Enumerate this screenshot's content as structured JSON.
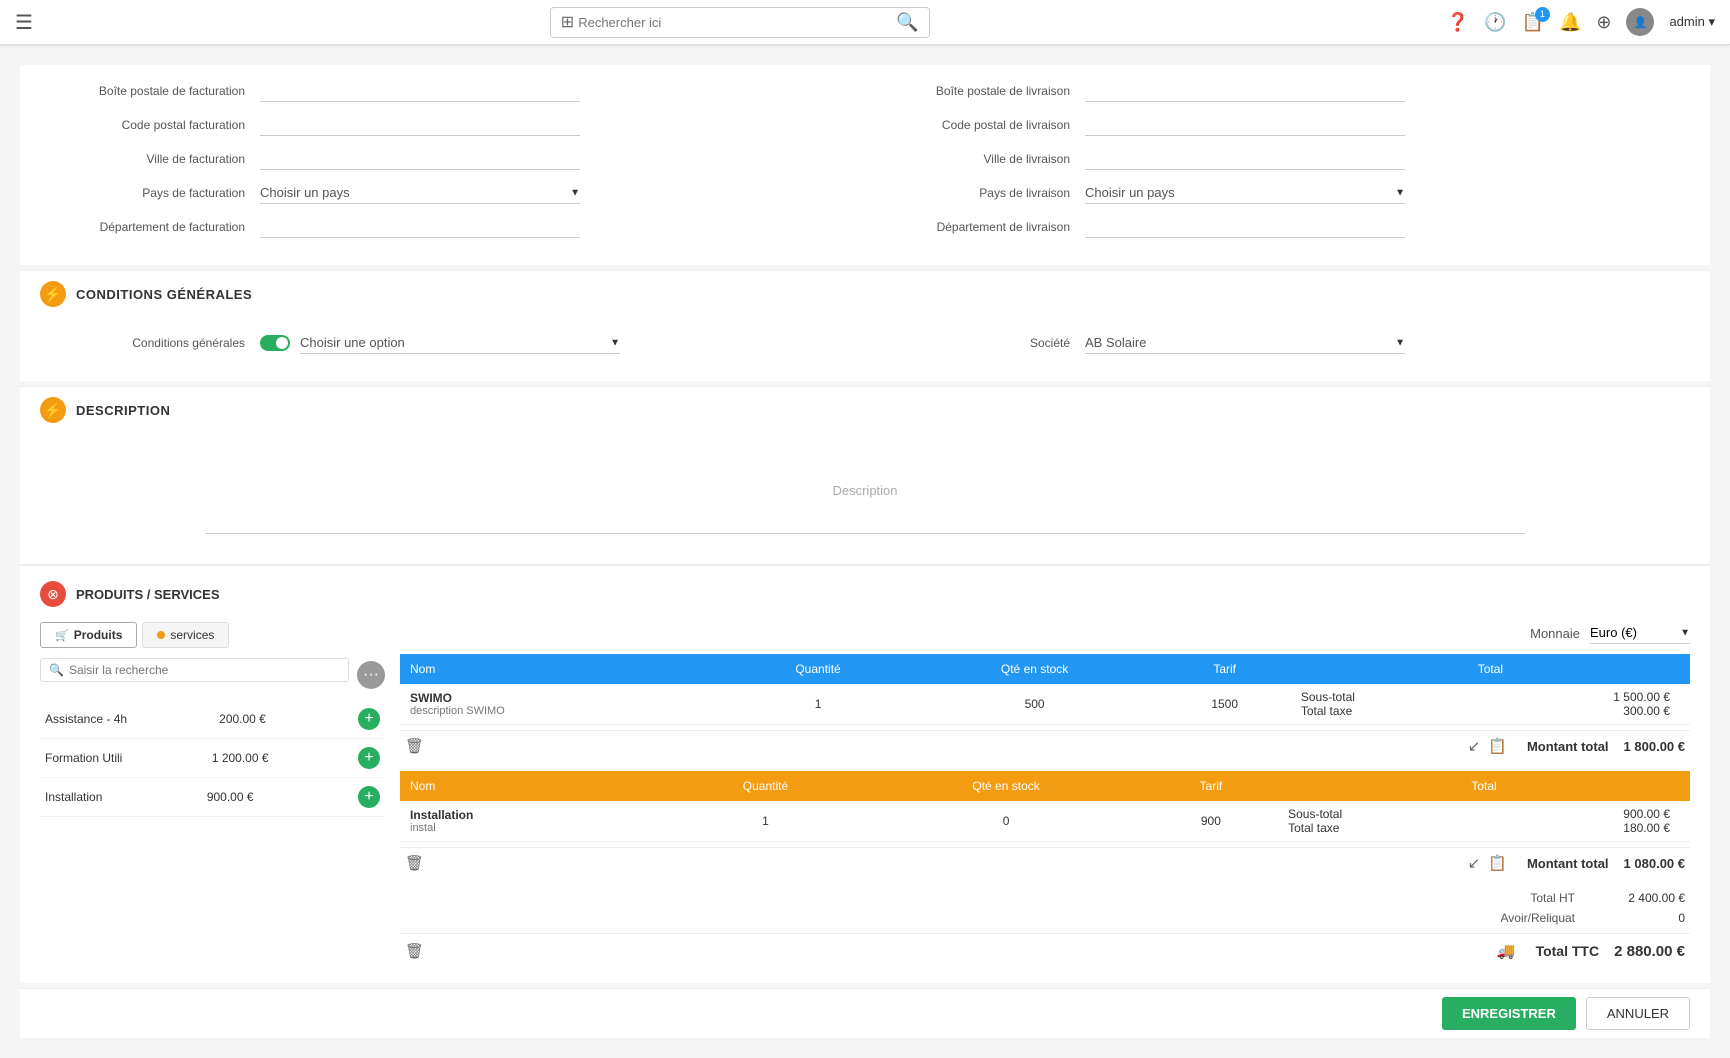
{
  "navbar": {
    "menu_icon": "☰",
    "search_placeholder": "Rechercher ici",
    "badge_count": "1",
    "admin_label": "admin ▾"
  },
  "billing": {
    "boite_postale_facturation_label": "Boîte postale de facturation",
    "code_postal_facturation_label": "Code postal facturation",
    "ville_facturation_label": "Ville de facturation",
    "pays_facturation_label": "Pays de facturation",
    "pays_facturation_placeholder": "Choisir un pays",
    "departement_facturation_label": "Département de facturation",
    "boite_postale_livraison_label": "Boîte postale de livraison",
    "code_postal_livraison_label": "Code postal de livraison",
    "ville_livraison_label": "Ville de livraison",
    "pays_livraison_label": "Pays de livraison",
    "pays_livraison_placeholder": "Choisir un pays",
    "departement_livraison_label": "Département de livraison"
  },
  "conditions": {
    "section_title": "Conditions générales",
    "conditions_generales_label": "Conditions générales",
    "choisir_option_placeholder": "Choisir une option",
    "societe_label": "Société",
    "societe_value": "AB Solaire"
  },
  "description": {
    "section_title": "Description",
    "placeholder": "Description"
  },
  "products": {
    "section_title": "Produits / Services",
    "tab_produits": "Produits",
    "tab_services": "services",
    "search_placeholder": "Saisir la recherche",
    "monnaie_label": "Monnaie",
    "monnaie_value": "Euro (€)",
    "services": [
      {
        "name": "Assistance - 4h",
        "price": "200.00 €"
      },
      {
        "name": "Formation Utili",
        "price": "1 200.00 €"
      },
      {
        "name": "Installation",
        "price": "900.00 €"
      }
    ],
    "table1": {
      "color": "blue",
      "headers": [
        "Nom",
        "Quantité",
        "Qté en stock",
        "Tarif",
        "Total"
      ],
      "row": {
        "name": "SWIMO",
        "description": "description SWIMO",
        "quantite": "1",
        "qte_stock": "500",
        "tarif": "1500",
        "sous_total_label": "Sous-total",
        "sous_total": "1 500.00 €",
        "total_taxe_label": "Total taxe",
        "total_taxe": "300.00 €"
      },
      "montant_total_label": "Montant total",
      "montant_total": "1 800.00 €"
    },
    "table2": {
      "color": "orange",
      "headers": [
        "Nom",
        "Quantité",
        "Qté en stock",
        "Tarif",
        "Total"
      ],
      "row": {
        "name": "Installation",
        "description": "instal",
        "quantite": "1",
        "qte_stock": "0",
        "tarif": "900",
        "sous_total_label": "Sous-total",
        "sous_total": "900.00 €",
        "total_taxe_label": "Total taxe",
        "total_taxe": "180.00 €"
      },
      "montant_total_label": "Montant total",
      "montant_total": "1 080.00 €"
    },
    "total_ht_label": "Total HT",
    "total_ht": "2 400.00 €",
    "avoir_reliquat_label": "Avoir/Reliquat",
    "avoir_reliquat": "0",
    "total_ttc_label": "Total TTC",
    "total_ttc": "2 880.00 €"
  },
  "footer": {
    "enregistrer": "ENREGISTRER",
    "annuler": "ANNULER"
  }
}
